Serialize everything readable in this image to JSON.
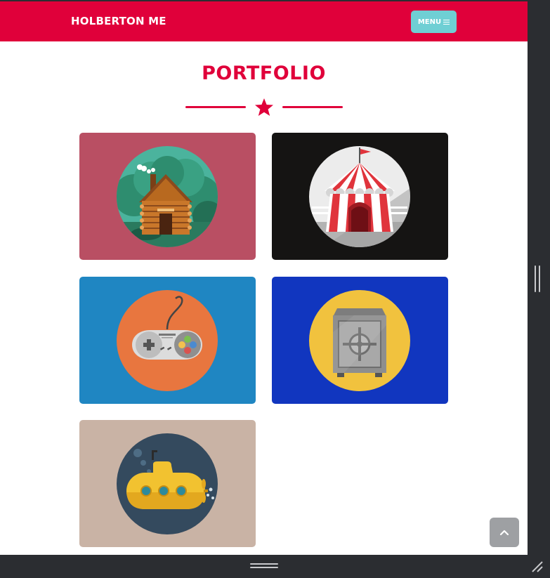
{
  "navbar": {
    "brand": "HOLBERTON ME",
    "menu_label": "MENU"
  },
  "section": {
    "title": "PORTFOLIO"
  },
  "portfolio": {
    "items": [
      {
        "icon": "log-cabin-icon",
        "bg": "#b94f63"
      },
      {
        "icon": "circus-tent-icon",
        "bg": "#151413"
      },
      {
        "icon": "game-controller-icon",
        "bg": "#1f86c2"
      },
      {
        "icon": "safe-icon",
        "bg": "#1136bf"
      },
      {
        "icon": "submarine-icon",
        "bg": "#c9b3a5"
      }
    ]
  },
  "colors": {
    "accent": "#e0003a",
    "menu_button": "#6fcfd4",
    "scroll_button": "#9ea0a3"
  }
}
